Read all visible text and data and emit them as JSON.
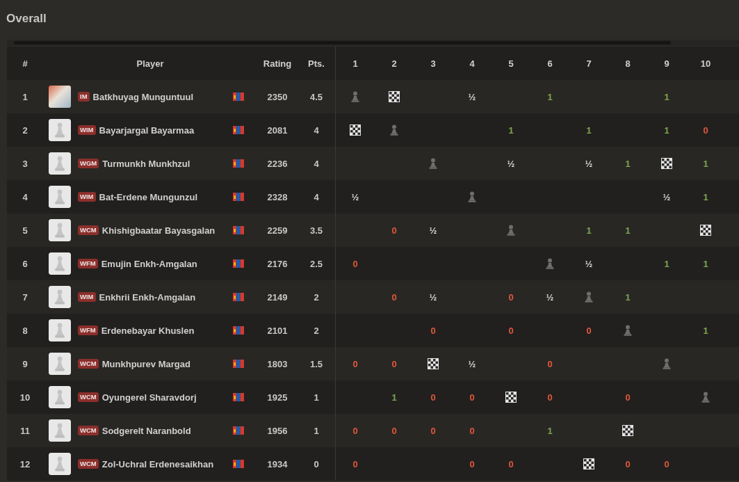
{
  "title": "Overall",
  "columns": {
    "rank": "#",
    "player": "Player",
    "rating": "Rating",
    "points": "Pts.",
    "rounds": [
      "1",
      "2",
      "3",
      "4",
      "5",
      "6",
      "7",
      "8",
      "9",
      "10"
    ]
  },
  "rows": [
    {
      "rank": "1",
      "avatar": {
        "kind": "photo"
      },
      "title": "IM",
      "name": "Batkhuyag Munguntuul",
      "rating": "2350",
      "points": "4.5",
      "cells": [
        {
          "kind": "self"
        },
        {
          "kind": "bye"
        },
        {
          "kind": "empty"
        },
        {
          "kind": "draw",
          "text": "½"
        },
        {
          "kind": "empty"
        },
        {
          "kind": "win",
          "text": "1"
        },
        {
          "kind": "empty"
        },
        {
          "kind": "empty"
        },
        {
          "kind": "win",
          "text": "1"
        },
        {
          "kind": "empty"
        }
      ]
    },
    {
      "rank": "2",
      "avatar": {
        "kind": "pawn"
      },
      "title": "WIM",
      "name": "Bayarjargal Bayarmaa",
      "rating": "2081",
      "points": "4",
      "cells": [
        {
          "kind": "bye"
        },
        {
          "kind": "self"
        },
        {
          "kind": "empty"
        },
        {
          "kind": "empty"
        },
        {
          "kind": "win",
          "text": "1"
        },
        {
          "kind": "empty"
        },
        {
          "kind": "win",
          "text": "1"
        },
        {
          "kind": "empty"
        },
        {
          "kind": "win",
          "text": "1"
        },
        {
          "kind": "loss",
          "text": "0"
        }
      ]
    },
    {
      "rank": "3",
      "avatar": {
        "kind": "pawn"
      },
      "title": "WGM",
      "name": "Turmunkh Munkhzul",
      "rating": "2236",
      "points": "4",
      "cells": [
        {
          "kind": "empty"
        },
        {
          "kind": "empty"
        },
        {
          "kind": "self"
        },
        {
          "kind": "empty"
        },
        {
          "kind": "draw",
          "text": "½"
        },
        {
          "kind": "empty"
        },
        {
          "kind": "draw",
          "text": "½"
        },
        {
          "kind": "win",
          "text": "1"
        },
        {
          "kind": "bye"
        },
        {
          "kind": "win",
          "text": "1"
        }
      ]
    },
    {
      "rank": "4",
      "avatar": {
        "kind": "pawn"
      },
      "title": "WIM",
      "name": "Bat-Erdene Mungunzul",
      "rating": "2328",
      "points": "4",
      "cells": [
        {
          "kind": "draw",
          "text": "½"
        },
        {
          "kind": "empty"
        },
        {
          "kind": "empty"
        },
        {
          "kind": "self"
        },
        {
          "kind": "empty"
        },
        {
          "kind": "empty"
        },
        {
          "kind": "empty"
        },
        {
          "kind": "empty"
        },
        {
          "kind": "draw",
          "text": "½"
        },
        {
          "kind": "win",
          "text": "1"
        }
      ]
    },
    {
      "rank": "5",
      "avatar": {
        "kind": "pawn"
      },
      "title": "WCM",
      "name": "Khishigbaatar Bayasgalan",
      "rating": "2259",
      "points": "3.5",
      "cells": [
        {
          "kind": "empty"
        },
        {
          "kind": "loss",
          "text": "0"
        },
        {
          "kind": "draw",
          "text": "½"
        },
        {
          "kind": "empty"
        },
        {
          "kind": "self"
        },
        {
          "kind": "empty"
        },
        {
          "kind": "win",
          "text": "1"
        },
        {
          "kind": "win",
          "text": "1"
        },
        {
          "kind": "empty"
        },
        {
          "kind": "bye"
        }
      ]
    },
    {
      "rank": "6",
      "avatar": {
        "kind": "pawn"
      },
      "title": "WFM",
      "name": "Emujin Enkh-Amgalan",
      "rating": "2176",
      "points": "2.5",
      "cells": [
        {
          "kind": "loss",
          "text": "0"
        },
        {
          "kind": "empty"
        },
        {
          "kind": "empty"
        },
        {
          "kind": "empty"
        },
        {
          "kind": "empty"
        },
        {
          "kind": "self"
        },
        {
          "kind": "draw",
          "text": "½"
        },
        {
          "kind": "empty"
        },
        {
          "kind": "win",
          "text": "1"
        },
        {
          "kind": "win",
          "text": "1"
        }
      ]
    },
    {
      "rank": "7",
      "avatar": {
        "kind": "pawn"
      },
      "title": "WIM",
      "name": "Enkhrii Enkh-Amgalan",
      "rating": "2149",
      "points": "2",
      "cells": [
        {
          "kind": "empty"
        },
        {
          "kind": "loss",
          "text": "0"
        },
        {
          "kind": "draw",
          "text": "½"
        },
        {
          "kind": "empty"
        },
        {
          "kind": "loss",
          "text": "0"
        },
        {
          "kind": "draw",
          "text": "½"
        },
        {
          "kind": "self"
        },
        {
          "kind": "win",
          "text": "1"
        },
        {
          "kind": "empty"
        },
        {
          "kind": "empty"
        }
      ]
    },
    {
      "rank": "8",
      "avatar": {
        "kind": "pawn"
      },
      "title": "WFM",
      "name": "Erdenebayar Khuslen",
      "rating": "2101",
      "points": "2",
      "cells": [
        {
          "kind": "empty"
        },
        {
          "kind": "empty"
        },
        {
          "kind": "loss",
          "text": "0"
        },
        {
          "kind": "empty"
        },
        {
          "kind": "loss",
          "text": "0"
        },
        {
          "kind": "empty"
        },
        {
          "kind": "loss",
          "text": "0"
        },
        {
          "kind": "self"
        },
        {
          "kind": "empty"
        },
        {
          "kind": "win",
          "text": "1"
        }
      ]
    },
    {
      "rank": "9",
      "avatar": {
        "kind": "pawn"
      },
      "title": "WCM",
      "name": "Munkhpurev Margad",
      "rating": "1803",
      "points": "1.5",
      "cells": [
        {
          "kind": "loss",
          "text": "0"
        },
        {
          "kind": "loss",
          "text": "0"
        },
        {
          "kind": "bye"
        },
        {
          "kind": "draw",
          "text": "½"
        },
        {
          "kind": "empty"
        },
        {
          "kind": "loss",
          "text": "0"
        },
        {
          "kind": "empty"
        },
        {
          "kind": "empty"
        },
        {
          "kind": "self"
        },
        {
          "kind": "empty"
        }
      ]
    },
    {
      "rank": "10",
      "avatar": {
        "kind": "pawn"
      },
      "title": "WCM",
      "name": "Oyungerel Sharavdorj",
      "rating": "1925",
      "points": "1",
      "cells": [
        {
          "kind": "empty"
        },
        {
          "kind": "win",
          "text": "1"
        },
        {
          "kind": "loss",
          "text": "0"
        },
        {
          "kind": "loss",
          "text": "0"
        },
        {
          "kind": "bye"
        },
        {
          "kind": "loss",
          "text": "0"
        },
        {
          "kind": "empty"
        },
        {
          "kind": "loss",
          "text": "0"
        },
        {
          "kind": "empty"
        },
        {
          "kind": "self"
        }
      ]
    },
    {
      "rank": "11",
      "avatar": {
        "kind": "pawn"
      },
      "title": "WCM",
      "name": "Sodgerelt Naranbold",
      "rating": "1956",
      "points": "1",
      "cells": [
        {
          "kind": "loss",
          "text": "0"
        },
        {
          "kind": "loss",
          "text": "0"
        },
        {
          "kind": "loss",
          "text": "0"
        },
        {
          "kind": "loss",
          "text": "0"
        },
        {
          "kind": "empty"
        },
        {
          "kind": "win",
          "text": "1"
        },
        {
          "kind": "empty"
        },
        {
          "kind": "bye"
        },
        {
          "kind": "empty"
        },
        {
          "kind": "empty"
        }
      ]
    },
    {
      "rank": "12",
      "avatar": {
        "kind": "pawn"
      },
      "title": "WCM",
      "name": "Zol-Uchral Erdenesaikhan",
      "rating": "1934",
      "points": "0",
      "cells": [
        {
          "kind": "loss",
          "text": "0"
        },
        {
          "kind": "empty"
        },
        {
          "kind": "empty"
        },
        {
          "kind": "loss",
          "text": "0"
        },
        {
          "kind": "loss",
          "text": "0"
        },
        {
          "kind": "empty"
        },
        {
          "kind": "bye"
        },
        {
          "kind": "loss",
          "text": "0"
        },
        {
          "kind": "loss",
          "text": "0"
        },
        {
          "kind": "empty"
        }
      ]
    }
  ]
}
